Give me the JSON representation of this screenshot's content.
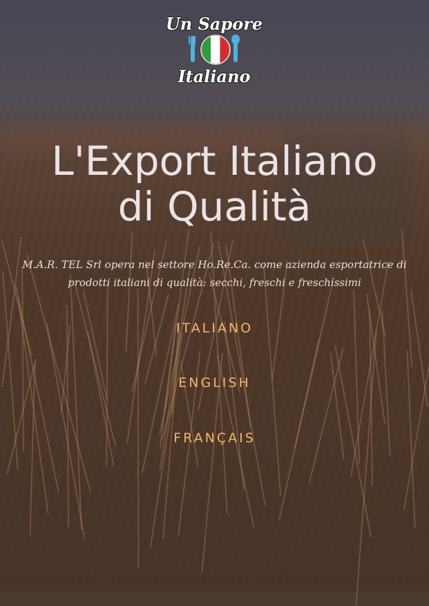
{
  "logo": {
    "line1": "Un Sapore",
    "line2": "Italiano",
    "icon_left": "fork-icon",
    "icon_center": "italian-flag-plate-icon",
    "icon_right": "spoon-icon"
  },
  "hero": {
    "title_line1": "L'Export Italiano",
    "title_line2": "di Qualità",
    "tagline_line1": "M.A.R. TEL Srl opera nel settore Ho.Re.Ca. come azienda esportatrice di",
    "tagline_line2": "prodotti italiani di qualità: secchi, freschi e freschissimi"
  },
  "languages": [
    {
      "label": "ITALIANO"
    },
    {
      "label": "ENGLISH"
    },
    {
      "label": "FRANÇAIS"
    }
  ],
  "colors": {
    "link": "#f2b86a",
    "title": "#e9e3e6"
  }
}
